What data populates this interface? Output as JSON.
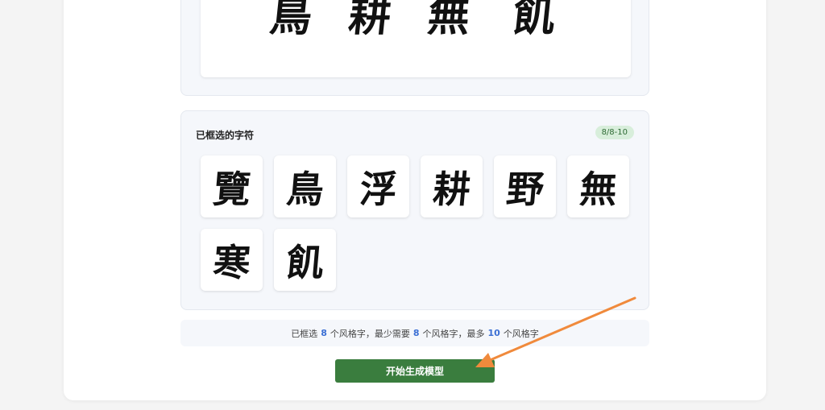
{
  "preview": {
    "glyphs": [
      "鳥",
      "耕",
      "無",
      "飢"
    ]
  },
  "selected_section": {
    "title": "已框选的字符",
    "badge": "8/8-10",
    "characters": [
      "覽",
      "鳥",
      "浮",
      "耕",
      "野",
      "無",
      "寒",
      "飢"
    ]
  },
  "summary": {
    "part1": "已框选",
    "selected_count": "8",
    "part2": "个风格字，最少需要",
    "min_count": "8",
    "part3": "个风格字，最多",
    "max_count": "10",
    "part4": "个风格字"
  },
  "actions": {
    "generate_label": "开始生成模型"
  },
  "colors": {
    "accent_green": "#3a7d3e",
    "badge_bg": "#d8eedb",
    "number_blue": "#3b6fd4",
    "annotation_arrow": "#f08a3c"
  }
}
